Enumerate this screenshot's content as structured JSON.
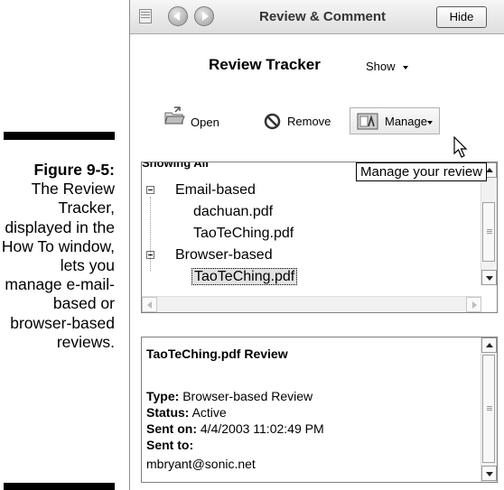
{
  "caption": {
    "figure_label": "Figure 9-5:",
    "text": "The Review Tracker, displayed in the How To window, lets you manage e-mail-based or browser-based reviews."
  },
  "panel": {
    "title": "Review & Comment",
    "hide_label": "Hide",
    "tracker_title": "Review Tracker",
    "show_label": "Show",
    "toolbar": {
      "open_label": "Open",
      "remove_label": "Remove",
      "manage_label": "Manage"
    },
    "tooltip": "Manage your review",
    "list": {
      "header": "Showing All",
      "groups": [
        {
          "label": "Email-based",
          "files": [
            "dachuan.pdf",
            "TaoTeChing.pdf"
          ]
        },
        {
          "label": "Browser-based",
          "files": [
            "TaoTeChing.pdf"
          ]
        }
      ]
    },
    "details": {
      "title": "TaoTeChing.pdf Review",
      "type_label": "Type:",
      "type_value": "Browser-based Review",
      "status_label": "Status:",
      "status_value": "Active",
      "sent_on_label": "Sent on:",
      "sent_on_value": "4/4/2003 11:02:49 PM",
      "sent_to_label": "Sent to:",
      "recipient": "mbryant@sonic.net"
    }
  }
}
